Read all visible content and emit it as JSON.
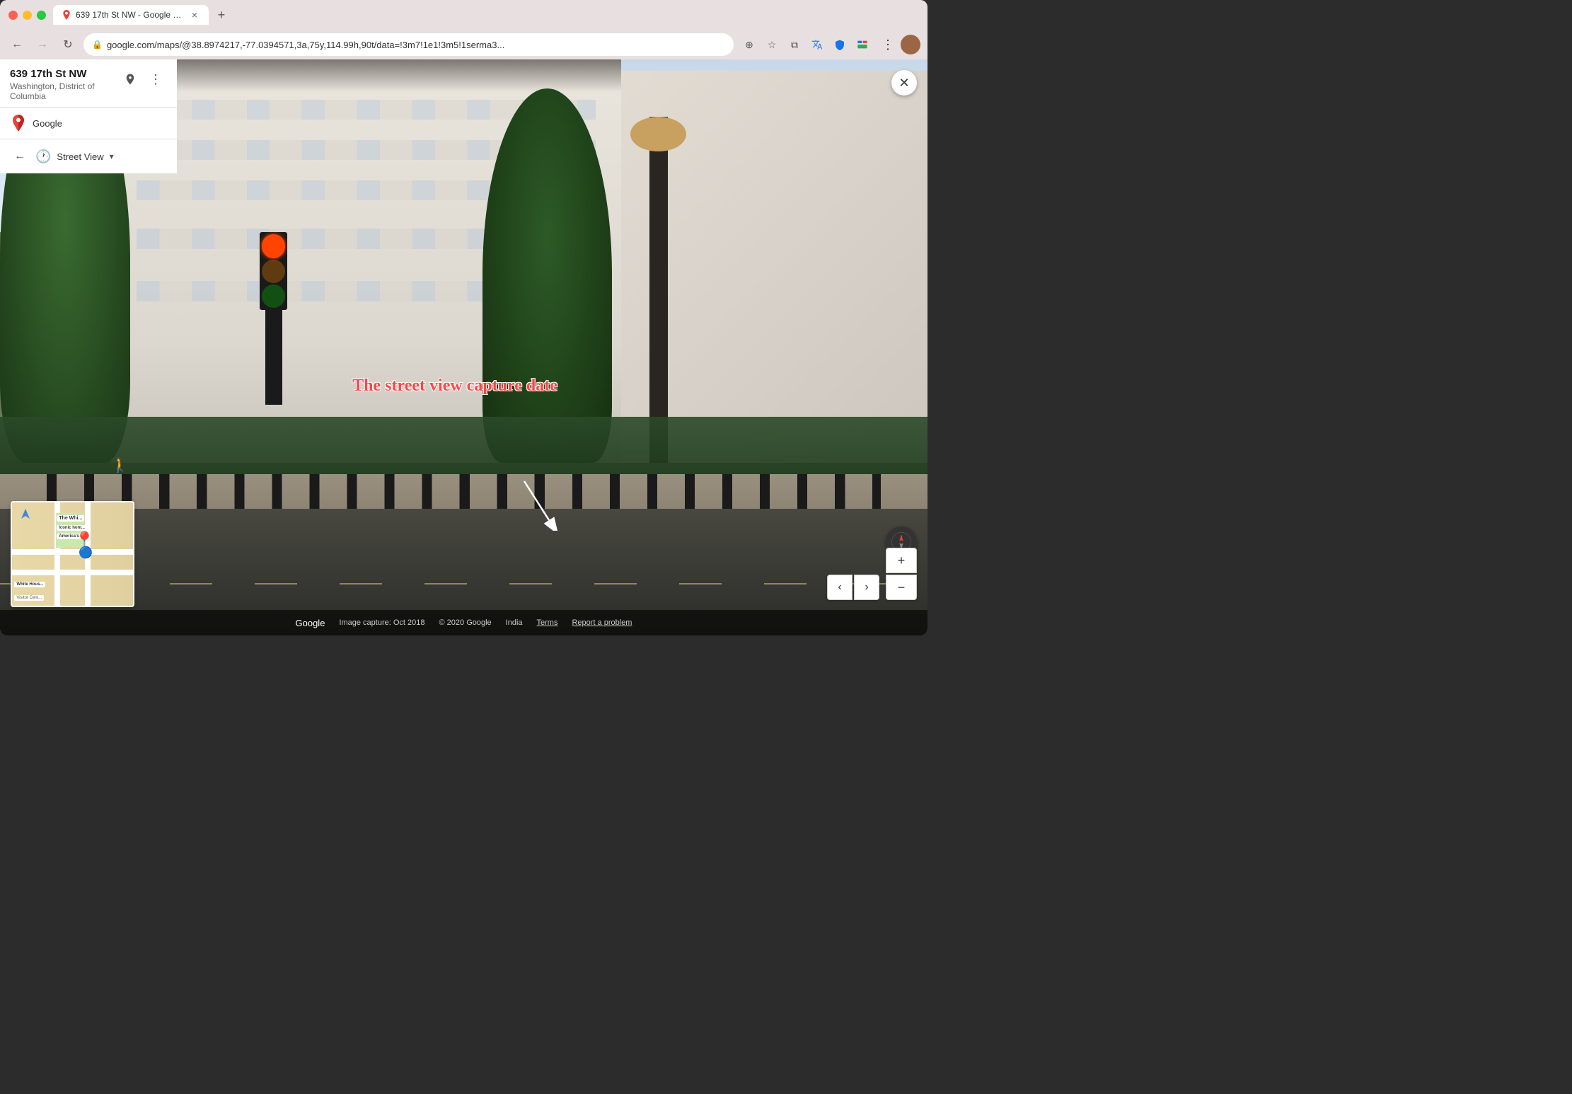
{
  "browser": {
    "tab_title": "639 17th St NW - Google Maps",
    "url": "google.com/maps/@38.8974217,-77.0394571,3a,75y,114.99h,90t/data=!3m7!1e1!3m5!1serma3...",
    "url_full": "https://google.com/maps/@38.8974217,-77.0394571,3a,75y,114.99h,90t/data=!3m7!1e1!3m5!1serma3...",
    "new_tab_label": "+",
    "back_disabled": false,
    "forward_disabled": true
  },
  "panel": {
    "address": "639 17th St NW",
    "city": "Washington, District of Columbia",
    "source": "Google",
    "mode": "Street View",
    "mode_dropdown": "▾"
  },
  "annotation": {
    "text": "The street view capture date",
    "arrow_direction": "down-left"
  },
  "bottom_bar": {
    "google_label": "Google",
    "image_capture": "Image capture: Oct 2018",
    "copyright": "© 2020 Google",
    "country": "India",
    "terms": "Terms",
    "report": "Report a problem"
  },
  "mini_map": {
    "label1": "The Whi...",
    "label2": "Iconic hom...",
    "label3": "America's",
    "footer": "White Hous...",
    "footer2": "Visitor Cent..."
  },
  "controls": {
    "zoom_in": "+",
    "zoom_out": "−",
    "prev_arrow": "‹",
    "next_arrow": "›",
    "close": "✕"
  },
  "icons": {
    "lock": "🔒",
    "star": "☆",
    "customize": "⊕",
    "translate": "A→",
    "extensions": "⧉",
    "menu": "⋮",
    "back": "←",
    "forward": "→",
    "refresh": "↻",
    "location_pin": "📍",
    "more": "⋮",
    "clock": "🕐",
    "chevron_down": "▾",
    "street_view_person": "🚶"
  }
}
